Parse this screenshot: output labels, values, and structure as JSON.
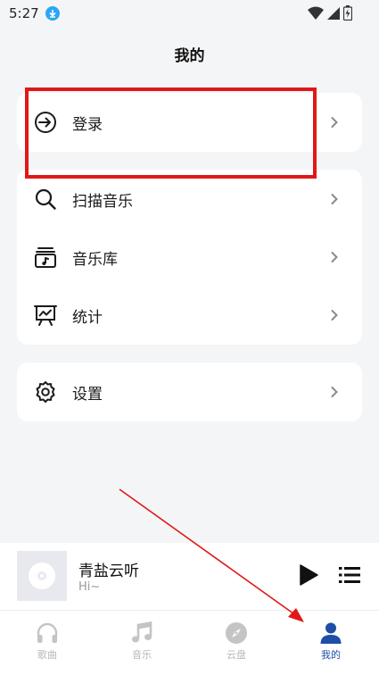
{
  "status_bar": {
    "time": "5:27"
  },
  "header": {
    "title": "我的"
  },
  "login_card": {
    "login_label": "登录"
  },
  "menu": {
    "scan_label": "扫描音乐",
    "library_label": "音乐库",
    "stats_label": "统计"
  },
  "settings_card": {
    "settings_label": "设置"
  },
  "player": {
    "title": "青盐云听",
    "subtitle": "Hi~"
  },
  "nav": {
    "items": [
      {
        "label": "歌曲",
        "icon": "headphones-icon"
      },
      {
        "label": "音乐",
        "icon": "music-note-icon"
      },
      {
        "label": "云盘",
        "icon": "compass-icon"
      },
      {
        "label": "我的",
        "icon": "person-icon"
      }
    ],
    "active": "我的"
  },
  "colors": {
    "accent": "#1e4fa6",
    "annotation": "#e01818",
    "background": "#f4f5f7",
    "download_badge": "#2aa7f5"
  }
}
